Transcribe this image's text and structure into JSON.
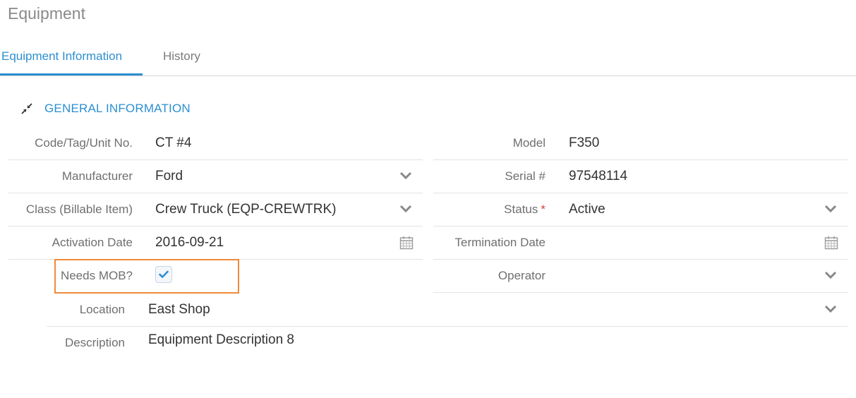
{
  "page": {
    "title": "Equipment"
  },
  "tabs": [
    {
      "label": "Equipment Information",
      "active": true
    },
    {
      "label": "History",
      "active": false
    }
  ],
  "section": {
    "title": "GENERAL INFORMATION",
    "icon": "collapse-arrows-icon"
  },
  "form": {
    "code": {
      "label": "Code/Tag/Unit No.",
      "value": "CT #4"
    },
    "model": {
      "label": "Model",
      "value": "F350"
    },
    "manufacturer": {
      "label": "Manufacturer",
      "value": "Ford"
    },
    "serial": {
      "label": "Serial #",
      "value": "97548114"
    },
    "class": {
      "label": "Class (Billable Item)",
      "value": "Crew Truck (EQP-CREWTRK)"
    },
    "status": {
      "label": "Status",
      "required_mark": "*",
      "value": "Active"
    },
    "activation_date": {
      "label": "Activation Date",
      "value": "2016-09-21"
    },
    "termination_date": {
      "label": "Termination Date",
      "value": ""
    },
    "needs_mob": {
      "label": "Needs MOB?",
      "checked": true
    },
    "operator": {
      "label": "Operator",
      "value": ""
    },
    "location": {
      "label": "Location",
      "value": "East Shop"
    },
    "description": {
      "label": "Description",
      "value": "Equipment Description 8"
    }
  },
  "colors": {
    "accent": "#2c8fd1",
    "highlight": "#ef8a3a",
    "required": "#d9443a"
  }
}
